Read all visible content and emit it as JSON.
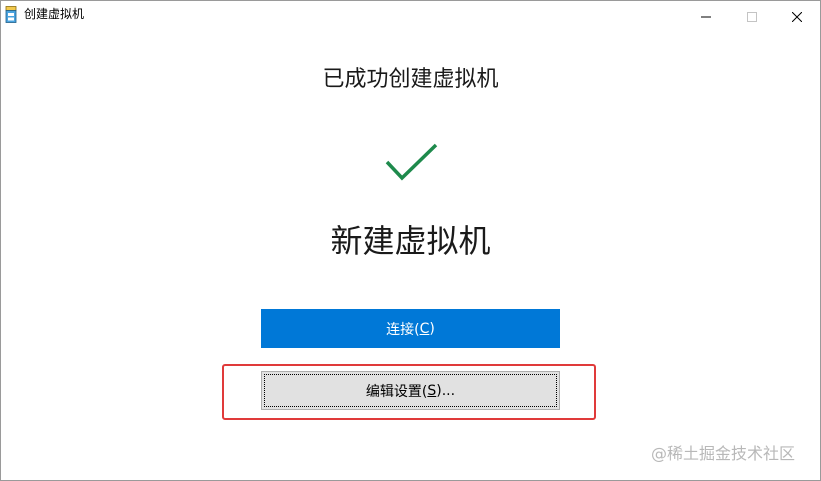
{
  "window": {
    "title": "创建虚拟机",
    "controls": {
      "minimize_icon": "minimize-icon",
      "maximize_icon": "maximize-icon",
      "close_icon": "close-icon"
    }
  },
  "main": {
    "status_heading": "已成功创建虚拟机",
    "status_icon": "checkmark-icon",
    "vm_name": "新建虚拟机",
    "connect_button": {
      "label_prefix": "连接(",
      "accelerator": "C",
      "label_suffix": ")"
    },
    "edit_settings_button": {
      "label_prefix": "编辑设置(",
      "accelerator": "S",
      "label_suffix": ")..."
    }
  },
  "watermark": "@稀土掘金技术社区",
  "colors": {
    "accent": "#0078d7",
    "check": "#1e8a4c",
    "highlight_frame": "#e03a3a",
    "secondary_button": "#e1e1e1"
  }
}
